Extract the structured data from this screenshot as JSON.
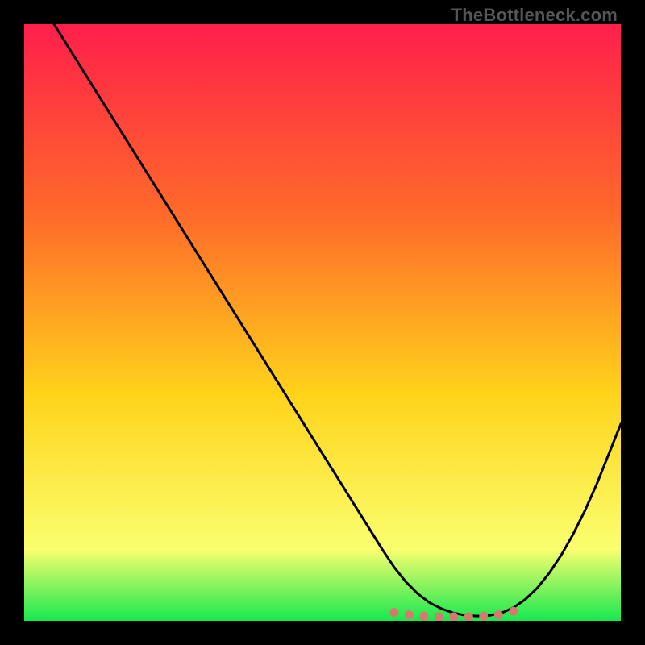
{
  "watermark": "TheBottleneck.com",
  "colors": {
    "gradient_top": "#ff1f4b",
    "gradient_mid1": "#ff6a2a",
    "gradient_mid2": "#ffd31a",
    "gradient_mid3": "#faff6e",
    "gradient_bottom": "#17e84f",
    "curve": "#000000",
    "dots": "#d9776e",
    "frame": "#000000"
  },
  "chart_data": {
    "type": "line",
    "title": "",
    "xlabel": "",
    "ylabel": "",
    "xlim": [
      0,
      100
    ],
    "ylim": [
      0,
      100
    ],
    "grid": false,
    "legend": false,
    "series": [
      {
        "name": "bottleneck-curve",
        "x": [
          0,
          5,
          10,
          15,
          20,
          25,
          30,
          35,
          40,
          45,
          50,
          55,
          60,
          62,
          64,
          66,
          68,
          70,
          72,
          74,
          76,
          78,
          80,
          82,
          84,
          86,
          88,
          90,
          92,
          94,
          96,
          98,
          100
        ],
        "y": [
          108,
          100,
          92,
          84,
          76,
          68,
          60,
          52,
          44,
          36,
          28,
          20,
          12,
          9,
          6.5,
          4.5,
          3,
          2,
          1.3,
          0.9,
          0.8,
          0.9,
          1.3,
          2.2,
          3.6,
          5.5,
          8,
          11,
          14.5,
          18.5,
          23,
          28,
          33
        ]
      }
    ],
    "markers": {
      "name": "optimal-zone-dots",
      "x": [
        62,
        64.5,
        67,
        69.5,
        72,
        74.5,
        77,
        79.5,
        82
      ],
      "y": [
        1.4,
        1.0,
        0.8,
        0.7,
        0.7,
        0.7,
        0.8,
        1.0,
        1.6
      ]
    }
  }
}
